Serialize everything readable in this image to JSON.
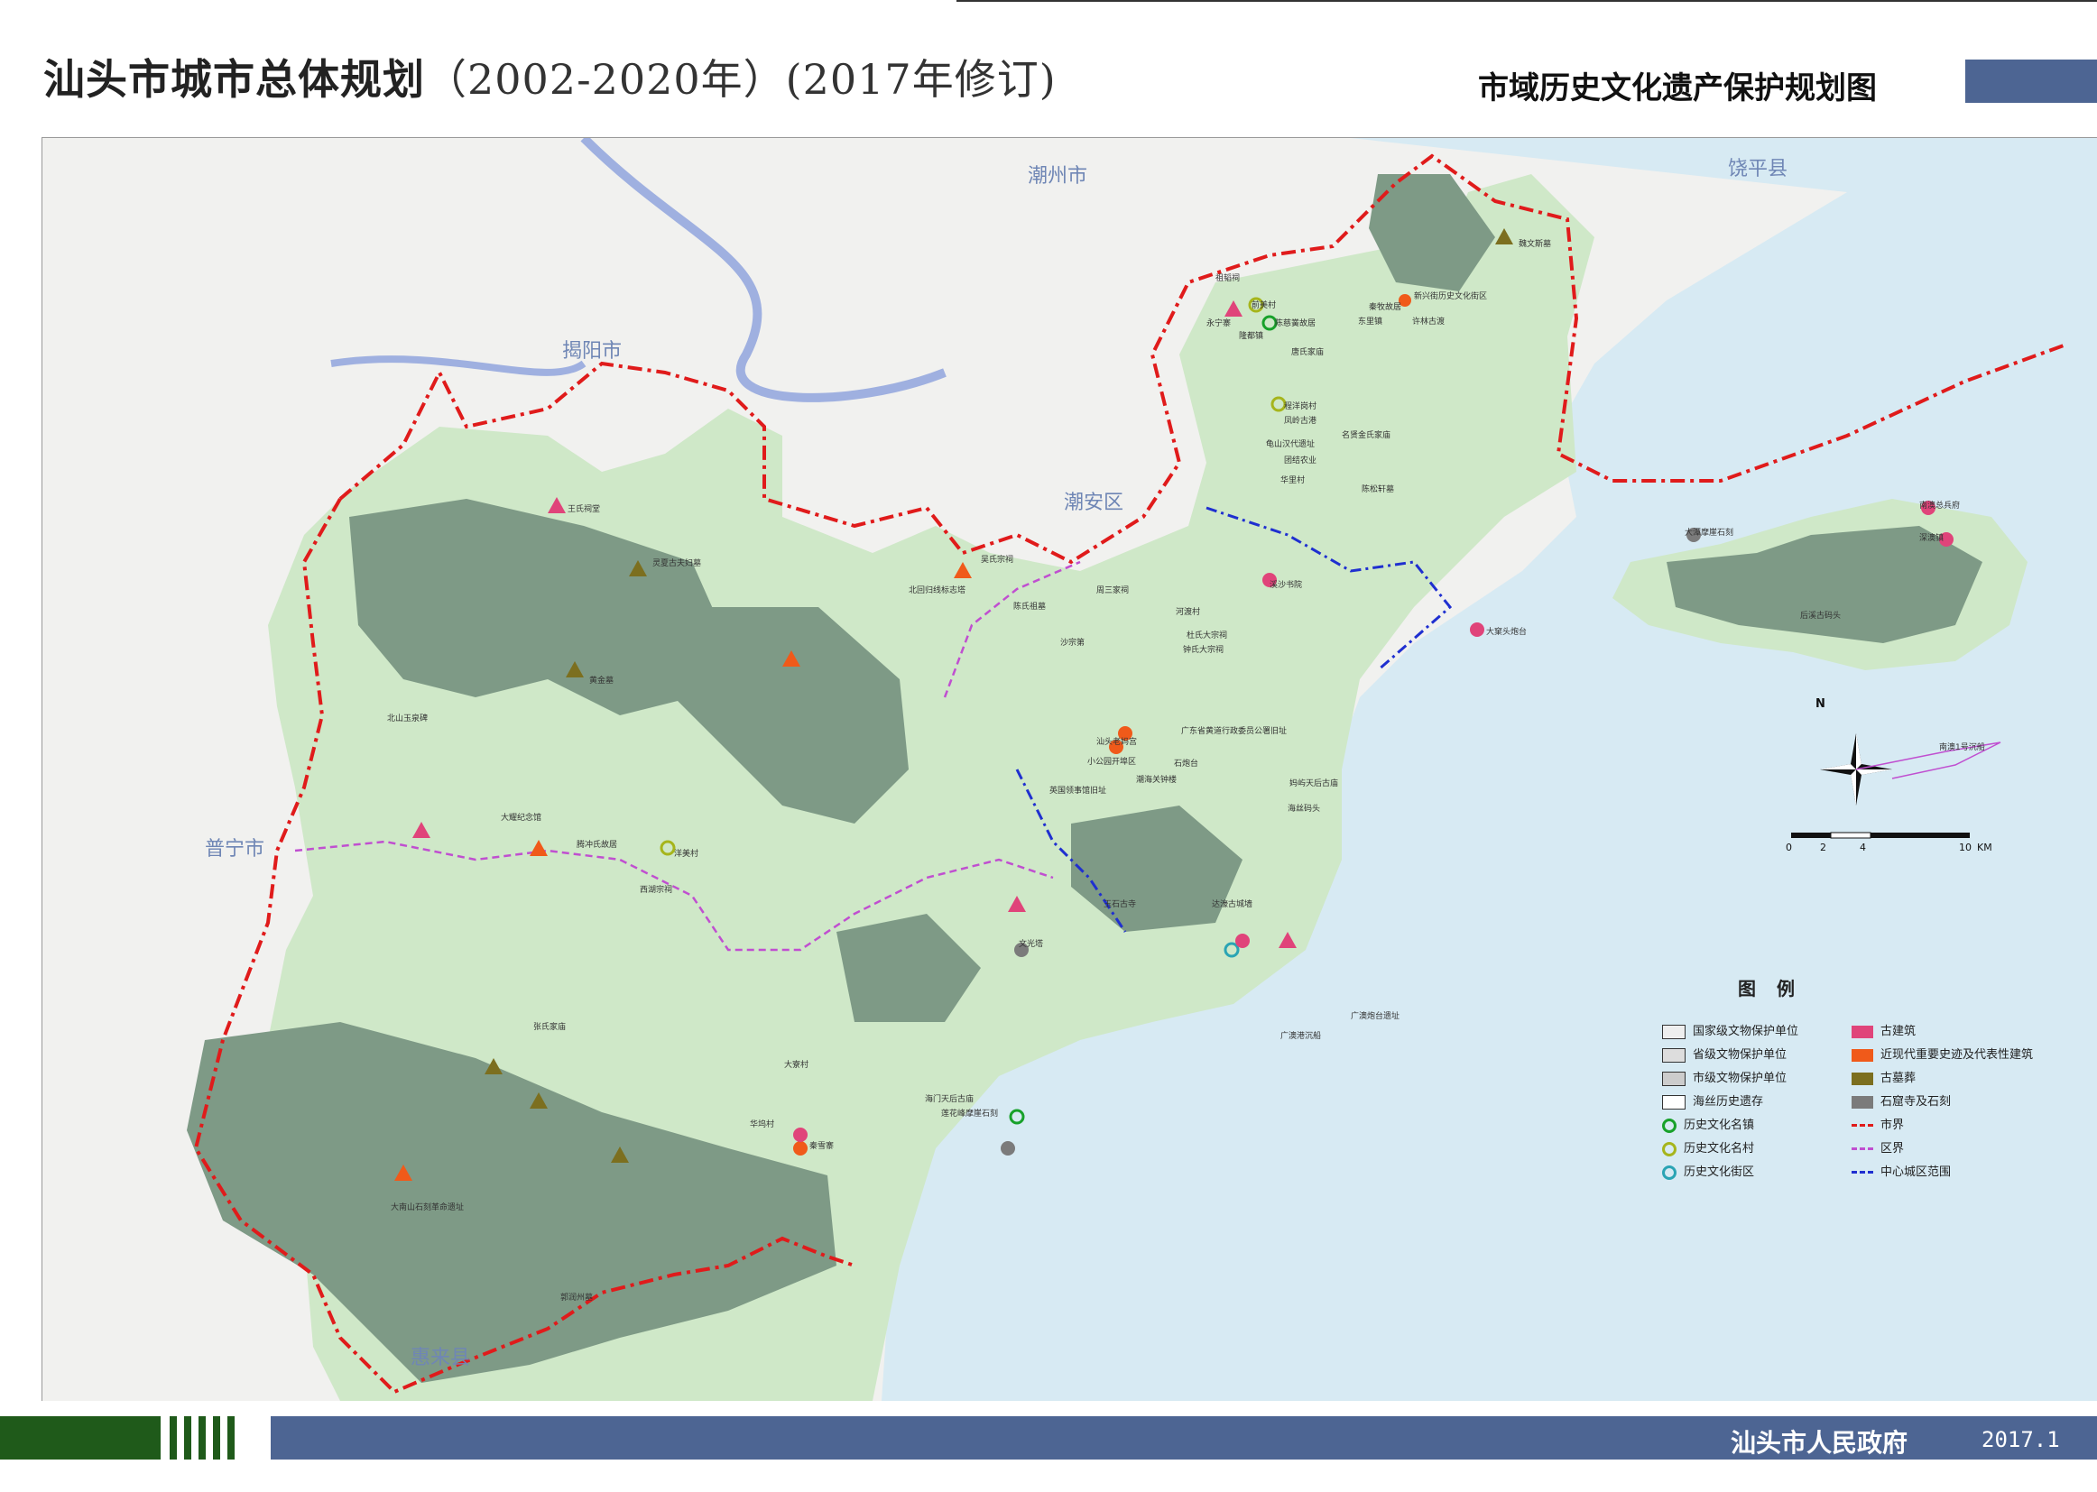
{
  "header": {
    "title_main": "汕头市城市总体规划",
    "title_sub": "（2002-2020年）(2017年修订)",
    "map_title": "市域历史文化遗产保护规划图"
  },
  "footer": {
    "organization": "汕头市人民政府",
    "date": "2017.1"
  },
  "colors": {
    "header_block": "#4d6593",
    "footer_green": "#1f5a1a",
    "sea": "#d7eaf3",
    "land_light": "#cfe8c8",
    "forest": "#7e9a86",
    "boundary_red": "#e01b1b",
    "district_purple": "#c04fd0",
    "center_blue": "#1f2fd0"
  },
  "place_labels": {
    "chaozhou": "潮州市",
    "raoping": "饶平县",
    "jieyang": "揭阳市",
    "chaoan": "潮安区",
    "puning": "普宁市",
    "huilai": "惠来县"
  },
  "sites": [
    "魏文斯墓",
    "祖韬祠",
    "新兴街历史文化街区",
    "秦牧故居",
    "许林古渡",
    "东里镇",
    "陈慈黉故居",
    "隆都镇",
    "永宁寨",
    "前美村",
    "唐氏家庙",
    "程洋岗村",
    "凤岭古港",
    "龟山汉代遗址",
    "名贤金氏家庙",
    "团结农业",
    "华里村",
    "陈松轩墓",
    "王氏祠堂",
    "灵夏古夫妇墓",
    "北回归线标志塔",
    "吴氏宗祠",
    "陈氏祖墓",
    "周三家祠",
    "溪沙书院",
    "大窠头炮台",
    "黄金墓",
    "北山玉泉碑",
    "大耀纪念馆",
    "腾冲氏故居",
    "洋美村",
    "西湖宗祠",
    "杜氏大宗祠",
    "钟氏大宗祠",
    "沙宗第",
    "河渡村",
    "小公园开埠区",
    "汕头老妈宫",
    "潮海关钟楼",
    "广东省黄道行政委员公署旧址",
    "石炮台",
    "英国领事馆旧址",
    "妈屿天后古庙",
    "海丝码头",
    "达濠古城墙",
    "玉石古寺",
    "华坞村",
    "大寮村",
    "秦雪寨",
    "海门天后古庙",
    "莲花峰摩崖石刻",
    "文光塔",
    "后溪古码头",
    "南澳总兵府",
    "深澳镇",
    "南澳1号沉船",
    "大潭摩崖石刻",
    "广澳港沉船",
    "广澳炮台遗址",
    "大南山石刻革命遗址",
    "郭润州墓",
    "张氏家庙"
  ],
  "legend": {
    "title": "图 例",
    "items_left": [
      "国家级文物保护单位",
      "省级文物保护单位",
      "市级文物保护单位",
      "海丝历史遗存",
      "历史文化名镇",
      "历史文化名村",
      "历史文化街区"
    ],
    "items_right": [
      "古建筑",
      "近现代重要史迹及代表性建筑",
      "古墓葬",
      "石窟寺及石刻",
      "市界",
      "区界",
      "中心城区范围"
    ]
  },
  "compass": {
    "north": "N"
  },
  "scale": {
    "ticks": [
      "0",
      "2",
      "4",
      "10"
    ],
    "unit": "KM"
  }
}
